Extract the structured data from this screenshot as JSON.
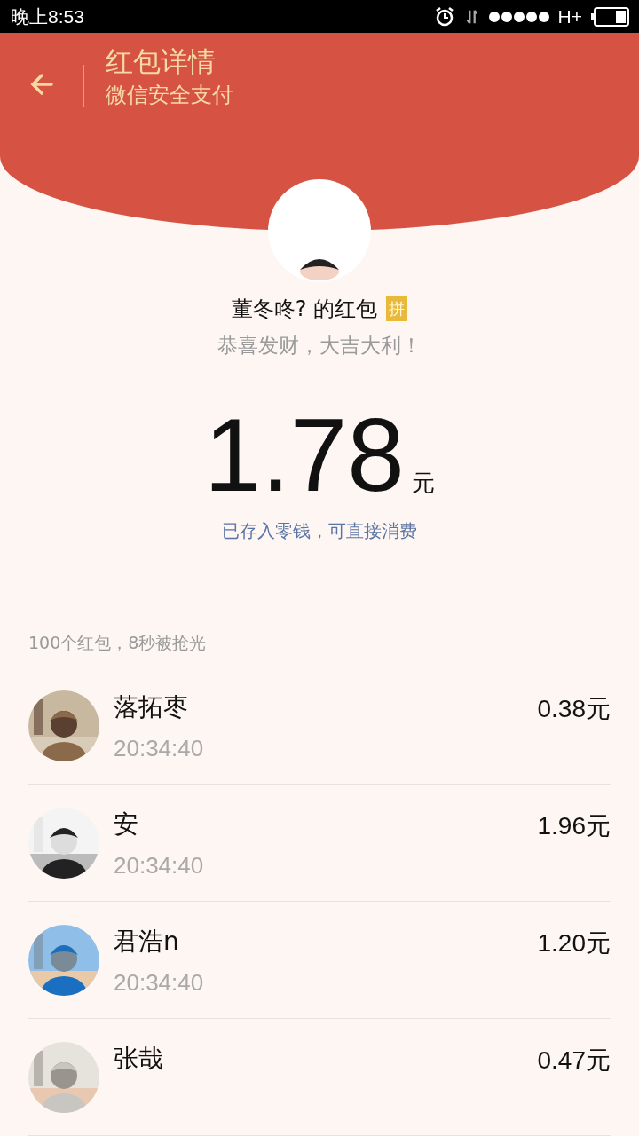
{
  "status_bar": {
    "time": "晚上8:53",
    "network": "H+"
  },
  "header": {
    "title": "红包详情",
    "subtitle": "微信安全支付"
  },
  "packet": {
    "sender": "董冬咚? 的红包",
    "badge": "拼",
    "greeting": "恭喜发财，大吉大利！",
    "amount": "1.78",
    "unit": "元",
    "note": "已存入零钱，可直接消费"
  },
  "summary": "100个红包，8秒被抢光",
  "rows": [
    {
      "name": "落拓枣",
      "time": "20:34:40",
      "amount": "0.38元"
    },
    {
      "name": "安",
      "time": "20:34:40",
      "amount": "1.96元"
    },
    {
      "name": "君浩n",
      "time": "20:34:40",
      "amount": "1.20元"
    },
    {
      "name": "张哉",
      "amount": "0.47元"
    }
  ]
}
